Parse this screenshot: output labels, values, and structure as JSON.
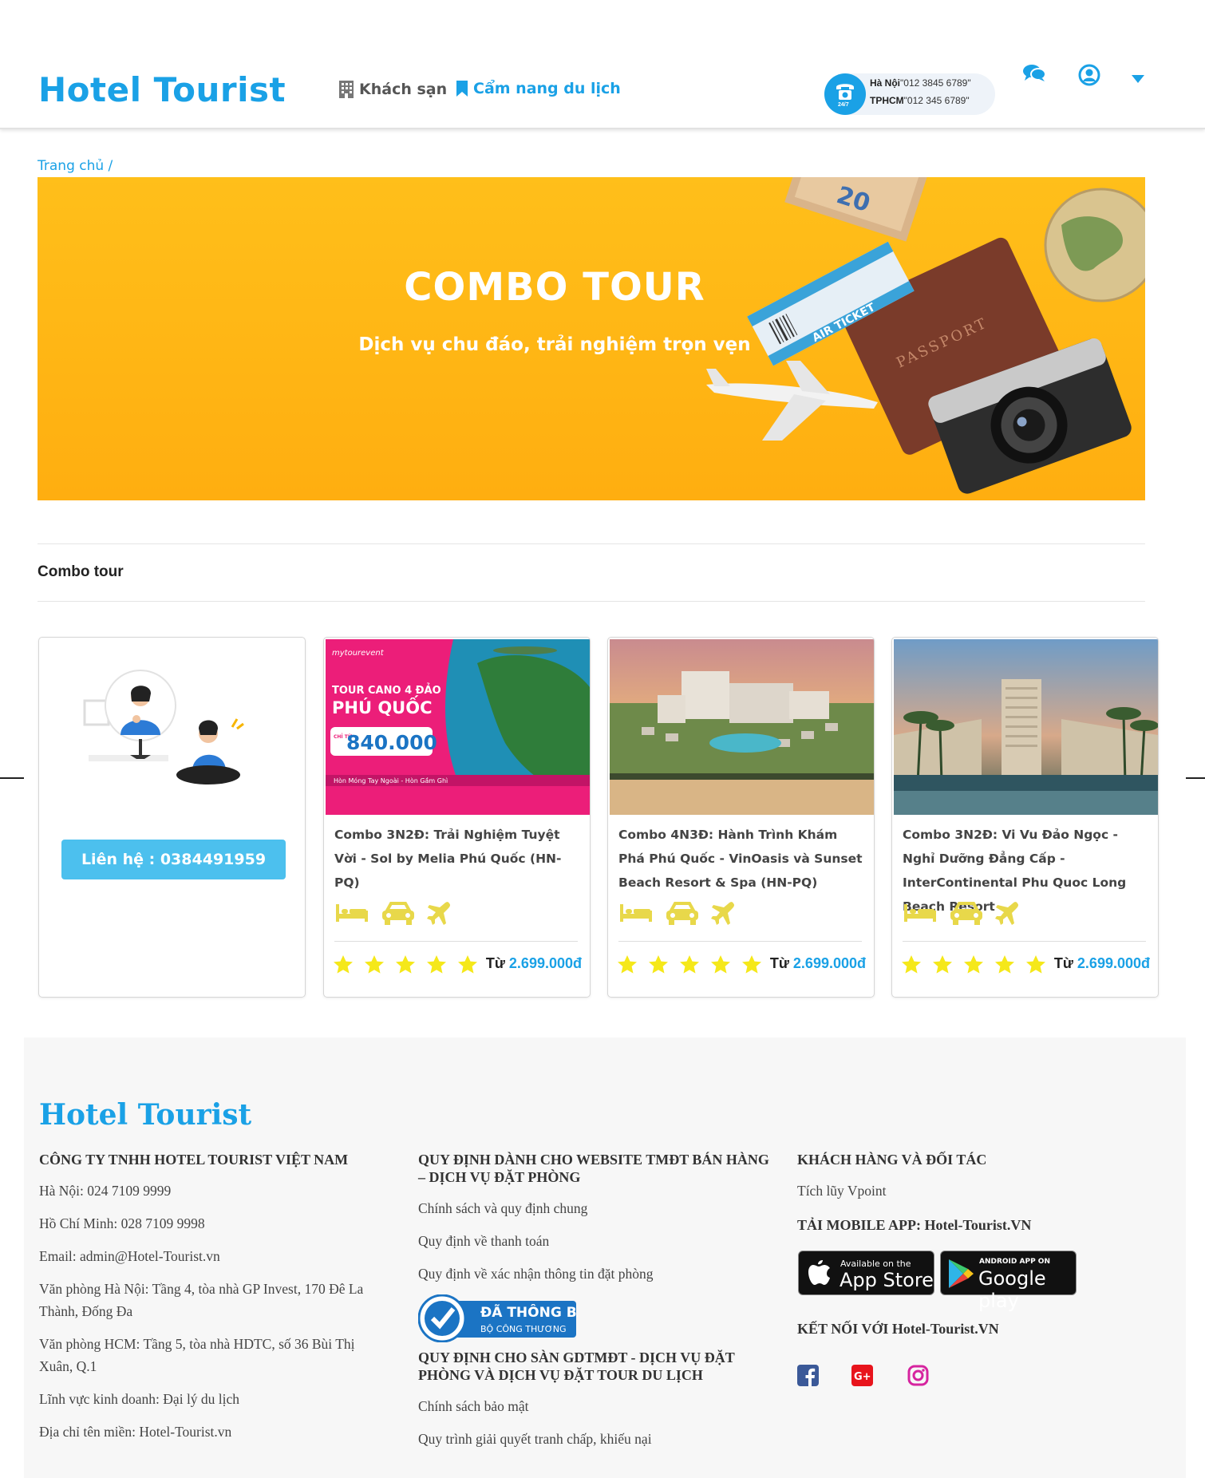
{
  "header": {
    "logo": "Hotel Tourist",
    "nav_hotel": "Khách sạn",
    "nav_guide": "Cẩm nang du lịch",
    "hotline": {
      "badge": "24/7",
      "hanoi_label": "Hà Nội",
      "hanoi_phone": "\"012 3845 6789\"",
      "hcm_label": "TPHCM",
      "hcm_phone": "\"012 345 6789\""
    }
  },
  "breadcrumb": "Trang chủ /",
  "banner": {
    "title": "COMBO TOUR",
    "subtitle": "Dịch vụ chu đáo, trải nghiệm trọn vẹn"
  },
  "section_title": "Combo tour",
  "contact_card": {
    "button": "Liên hệ : 0384491959"
  },
  "cards": [
    {
      "promo_brand": "mytourevent",
      "promo_line1": "TOUR CANO 4 ĐẢO",
      "promo_line2": "PHÚ QUỐC",
      "promo_from": "CHỈ TỪ",
      "promo_price": "840.000",
      "promo_footer": "Hòn Móng Tay Ngoài - Hòn Gầm Ghì",
      "name": "Combo 3N2Đ: Trải Nghiệm Tuyệt Vời - Sol by Melia Phú Quốc (HN-PQ)",
      "price_prefix": "Từ",
      "price": "2.699.000đ"
    },
    {
      "name": "Combo 4N3Đ: Hành Trình Khám Phá Phú Quốc - VinOasis và Sunset Beach Resort & Spa (HN-PQ)",
      "price_prefix": "Từ",
      "price": "2.699.000đ"
    },
    {
      "name": "Combo 3N2Đ: Vi Vu Đảo Ngọc - Nghỉ Dưỡng Đẳng Cấp - InterContinental Phu Quoc Long Beach Resort",
      "price_prefix": "Từ",
      "price": "2.699.000đ"
    }
  ],
  "footer": {
    "logo": "Hotel Tourist",
    "col1": {
      "heading": "CÔNG TY TNHH HOTEL TOURIST VIỆT NAM",
      "items": [
        "Hà Nội: 024 7109 9999",
        "Hồ Chí Minh: 028 7109 9998",
        "Email: admin@Hotel-Tourist.vn",
        "Văn phòng Hà Nội: Tầng 4, tòa nhà GP Invest, 170 Đê La Thành, Đống Đa",
        "Văn phòng HCM: Tầng 5, tòa nhà HDTC, số 36 Bùi Thị Xuân, Q.1",
        "Lĩnh vực kinh doanh: Đại lý du lịch",
        "Địa chỉ tên miền: Hotel-Tourist.vn"
      ]
    },
    "col2": {
      "heading1": "QUY ĐỊNH DÀNH CHO WEBSITE TMĐT BÁN HÀNG – DỊCH VỤ ĐẶT PHÒNG",
      "links1": [
        "Chính sách và quy định chung",
        "Quy định về thanh toán",
        "Quy định về xác nhận thông tin đặt phòng"
      ],
      "badge_line1": "ĐÃ THÔNG BÁO",
      "badge_line2": "BỘ CÔNG THƯƠNG",
      "heading2": "QUY ĐỊNH CHO SÀN GDTMĐT - DỊCH VỤ ĐẶT PHÒNG VÀ DỊCH VỤ ĐẶT TOUR DU LỊCH",
      "links2": [
        "Chính sách bảo mật",
        "Quy trình giải quyết tranh chấp, khiếu nại"
      ]
    },
    "col3": {
      "heading1": "KHÁCH HÀNG VÀ ĐỐI TÁC",
      "link1": "Tích lũy Vpoint",
      "heading2": "TẢI MOBILE APP: Hotel-Tourist.VN",
      "appstore_small": "Available on the",
      "appstore_big": "App Store",
      "google_small": "ANDROID APP ON",
      "google_big": "Google play",
      "heading3": "KẾT NỐI VỚI Hotel-Tourist.VN"
    }
  },
  "colors": {
    "brand": "#1aa1e6",
    "banner": "#ffb515",
    "star": "#f5e81a",
    "amenity": "#e8d84a"
  }
}
